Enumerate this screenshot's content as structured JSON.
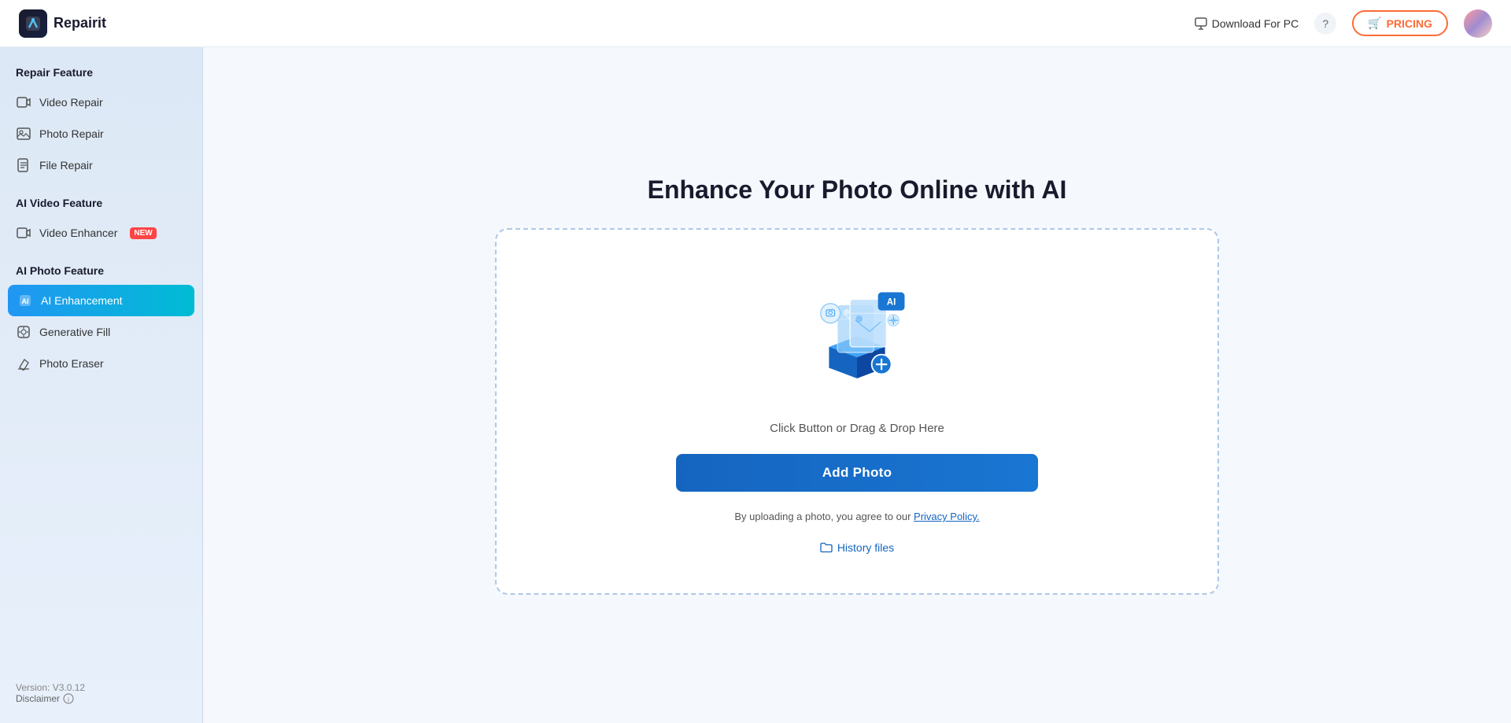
{
  "header": {
    "logo_text": "Repairit",
    "download_label": "Download For PC",
    "pricing_label": "PRICING",
    "pricing_icon": "🛒"
  },
  "sidebar": {
    "section_repair": "Repair Feature",
    "section_ai_video": "AI Video Feature",
    "section_ai_photo": "AI Photo Feature",
    "items_repair": [
      {
        "label": "Video Repair",
        "icon": "▶",
        "active": false
      },
      {
        "label": "Photo Repair",
        "icon": "🖼",
        "active": false
      },
      {
        "label": "File Repair",
        "icon": "📄",
        "active": false
      }
    ],
    "items_ai_video": [
      {
        "label": "Video Enhancer",
        "icon": "🎬",
        "new": true,
        "active": false
      }
    ],
    "items_ai_photo": [
      {
        "label": "AI Enhancement",
        "icon": "✦",
        "active": true
      },
      {
        "label": "Generative Fill",
        "icon": "◇",
        "active": false
      },
      {
        "label": "Photo Eraser",
        "icon": "◇",
        "active": false
      }
    ],
    "footer": {
      "version": "Version: V3.0.12",
      "disclaimer": "Disclaimer"
    }
  },
  "main": {
    "page_title": "Enhance Your Photo Online with AI",
    "drop_hint": "Click Button or Drag & Drop Here",
    "add_photo_label": "Add Photo",
    "privacy_text": "By uploading a photo, you agree to our ",
    "privacy_link_label": "Privacy Policy.",
    "history_label": "History files"
  }
}
